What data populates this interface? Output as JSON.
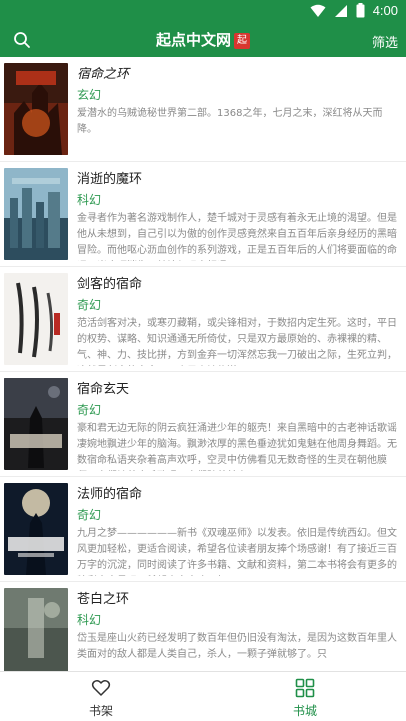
{
  "status": {
    "time": "4:00"
  },
  "appbar": {
    "title": "起点中文网",
    "seal": "起点",
    "filter_label": "筛选"
  },
  "colors": {
    "primary": "#1f8f48",
    "genre": "#2f9a52",
    "desc": "#8a8a8a"
  },
  "books": [
    {
      "title": "宿命之环",
      "genre": "玄幻",
      "description": "爱潜水的乌贼诡秘世界第二部。1368之年，七月之末，深红将从天而降。"
    },
    {
      "title": "消逝的魔环",
      "genre": "科幻",
      "description": "金寻者作为著名游戏制作人，楚千城对于灵感有着永无止境的渴望。但是他从未想到，自己引以为傲的创作灵感竟然来自五百年后亲身经历的黑暗冒险。而他呕心沥血创作的系列游戏，正是五百年后的人们将要面临的命运。当魔环消失，梦境与现实相遇，"
    },
    {
      "title": "剑客的宿命",
      "genre": "奇幻",
      "description": "范活剑客对决，或寒刃藏鞘，或尖锋相对，于数招内定生死。这时，平日的权势、谋略、知识通通无所倚仗，只是双方最原始的、赤裸裸的精、气、神、力、技比拼，方到金弃一切浑然忘我一刀破出之际，生死立判，这就是剑客的宿命。一个男人被传送"
    },
    {
      "title": "宿命玄天",
      "genre": "奇幻",
      "description": "豪和君无边无际的阴云疯狂涌进少年的躯壳！来自黑暗中的古老神话歌谣凄婉地飘进少年的脑海。飘渺浓厚的黑色垂迹犹如鬼魅在他周身舞蹈。无数宿命私语夹杂着高声欢呼，空灵中仿佛看见无数奇怪的生灵在朝他膜拜。它们被着皮毛歌唱，它们踏着鼓点"
    },
    {
      "title": "法师的宿命",
      "genre": "奇幻",
      "description": "九月之梦——————新书《双魂巫师》以发表。依旧是传统西幻。但文风更加轻松，更适合阅读，希望各位读者朋友捧个场感谢！有了接近三百万字的沉淀，同时阅读了许多书籍、文献和资料，第二本书将会有更多的精彩内容呈现，希望大家喜欢！如"
    },
    {
      "title": "苍白之环",
      "genre": "科幻",
      "description": "岱玉是座山火药已经发明了数百年但仍旧没有淘汰，是因为这数百年里人类面对的敌人都是人类自己，杀人，一颗子弹就够了。只"
    }
  ],
  "bottom_tabs": [
    {
      "label": "书架",
      "icon": "heart-icon"
    },
    {
      "label": "书城",
      "icon": "grid-icon"
    }
  ]
}
